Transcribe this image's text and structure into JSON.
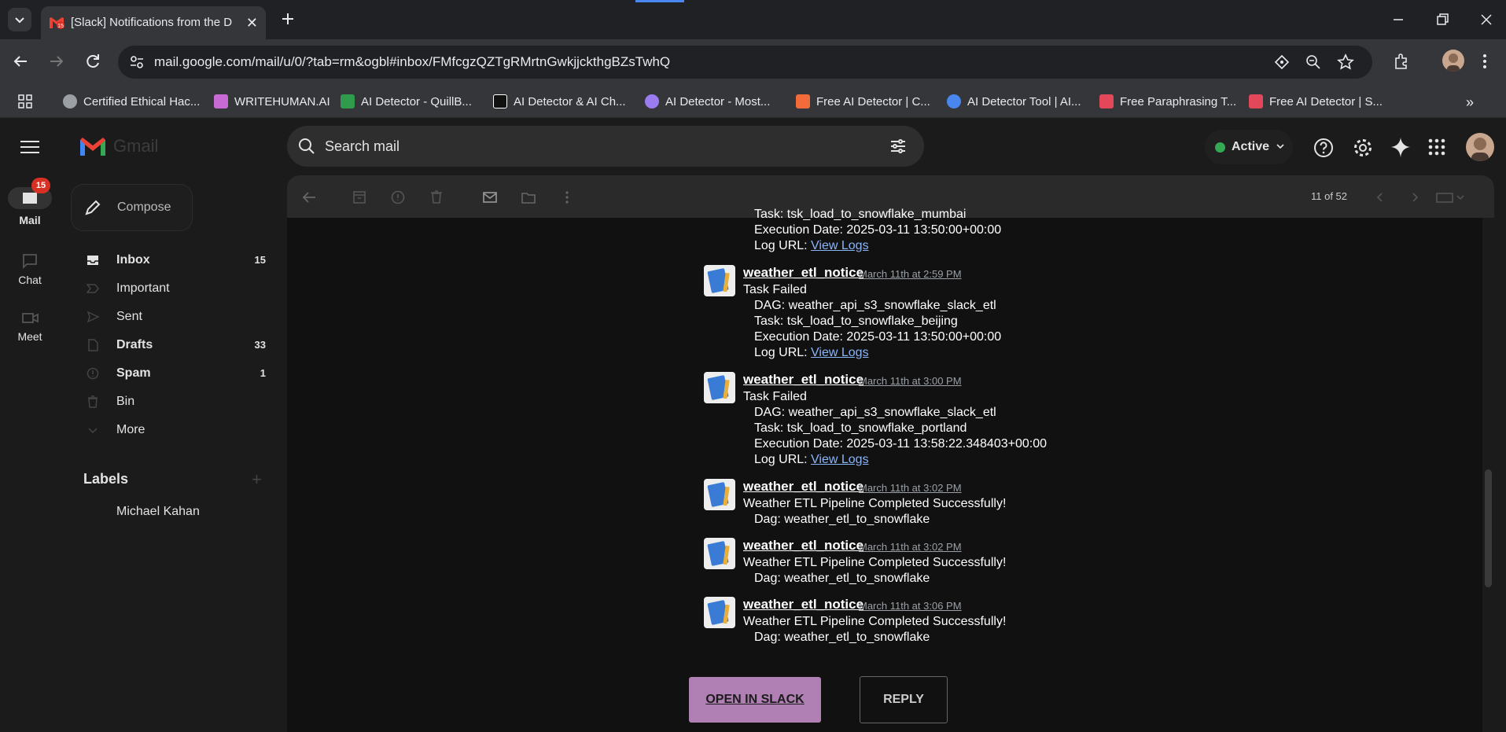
{
  "browser": {
    "tab_title": "[Slack] Notifications from the D",
    "url": "mail.google.com/mail/u/0/?tab=rm&ogbl#inbox/FMfcgzQZTgRMrtnGwkjjckthgBZsTwhQ",
    "bookmarks": [
      {
        "label": "Certified Ethical Hac...",
        "color": "#9aa0a6"
      },
      {
        "label": "WRITEHUMAN.AI",
        "color": "#c86ad4"
      },
      {
        "label": "AI Detector - QuillB...",
        "color": "#2e9b4d"
      },
      {
        "label": "AI Detector & AI Ch...",
        "color": "#ffffff"
      },
      {
        "label": "AI Detector - Most...",
        "color": "#9a7cf0"
      },
      {
        "label": "Free AI Detector | C...",
        "color": "#f26b3a"
      },
      {
        "label": "AI Detector Tool | AI...",
        "color": "#4a86f0"
      },
      {
        "label": "Free Paraphrasing T...",
        "color": "#e2475a"
      },
      {
        "label": "Free AI Detector | S...",
        "color": "#e2475a"
      }
    ]
  },
  "gmail": {
    "logo_text": "Gmail",
    "search_placeholder": "Search mail",
    "status": "Active",
    "compose": "Compose",
    "rail": {
      "mail": "Mail",
      "mail_badge": "15",
      "chat": "Chat",
      "meet": "Meet"
    },
    "nav": [
      {
        "label": "Inbox",
        "count": "15",
        "bold": true
      },
      {
        "label": "Important",
        "count": "",
        "bold": false
      },
      {
        "label": "Sent",
        "count": "",
        "bold": false
      },
      {
        "label": "Drafts",
        "count": "33",
        "bold": true
      },
      {
        "label": "Spam",
        "count": "1",
        "bold": true
      },
      {
        "label": "Bin",
        "count": "",
        "bold": false
      },
      {
        "label": "More",
        "count": "",
        "bold": false
      }
    ],
    "labels_title": "Labels",
    "labels": [
      "Michael Kahan"
    ],
    "pager": "11 of 52"
  },
  "email": {
    "partial": {
      "task": "Task: tsk_load_to_snowflake_mumbai",
      "exec": "Execution Date: 2025-03-11 13:50:00+00:00",
      "log_prefix": "Log URL: ",
      "log_link": "View Logs"
    },
    "messages": [
      {
        "sender": "weather_etl_notice",
        "time": "March 11th at 2:59 PM",
        "headline": "Task Failed",
        "lines": [
          "DAG: weather_api_s3_snowflake_slack_etl",
          "Task: tsk_load_to_snowflake_beijing",
          "Execution Date: 2025-03-11 13:50:00+00:00"
        ],
        "log_prefix": "Log URL: ",
        "log_link": "View Logs"
      },
      {
        "sender": "weather_etl_notice",
        "time": "March 11th at 3:00 PM",
        "headline": "Task Failed",
        "lines": [
          "DAG: weather_api_s3_snowflake_slack_etl",
          "Task: tsk_load_to_snowflake_portland",
          "Execution Date: 2025-03-11 13:58:22.348403+00:00"
        ],
        "log_prefix": "Log URL: ",
        "log_link": "View Logs"
      },
      {
        "sender": "weather_etl_notice",
        "time": "March 11th at 3:02 PM",
        "headline": "Weather ETL Pipeline Completed Successfully!",
        "lines": [
          "Dag: weather_etl_to_snowflake"
        ]
      },
      {
        "sender": "weather_etl_notice",
        "time": "March 11th at 3:02 PM",
        "headline": "Weather ETL Pipeline Completed Successfully!",
        "lines": [
          "Dag: weather_etl_to_snowflake"
        ]
      },
      {
        "sender": "weather_etl_notice",
        "time": "March 11th at 3:06 PM",
        "headline": "Weather ETL Pipeline Completed Successfully!",
        "lines": [
          "Dag: weather_etl_to_snowflake"
        ]
      }
    ],
    "open_button": "OPEN IN SLACK",
    "reply_button": "REPLY"
  },
  "colors": {
    "accent": "#b07fb3",
    "link": "#8ab4f8",
    "active": "#34a853",
    "badge": "#d93025"
  }
}
